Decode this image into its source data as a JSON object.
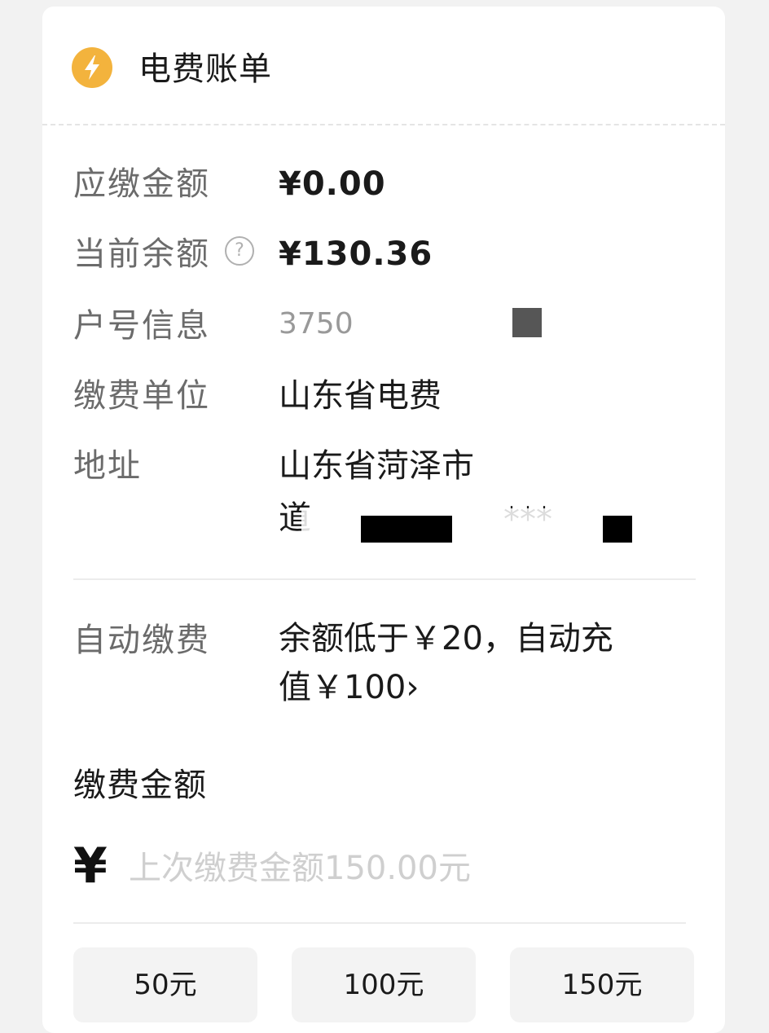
{
  "header": {
    "title": "电费账单",
    "icon": "lightning-icon",
    "icon_color": "#f3b33d"
  },
  "bill": {
    "amount_due_label": "应缴金额",
    "amount_due_value": "¥0.00",
    "balance_label": "当前余额",
    "balance_value": "¥130.36",
    "account_label": "户号信息",
    "account_value": "3750",
    "payee_label": "缴费单位",
    "payee_value": "山东省电费",
    "address_label": "地址",
    "address_line1": "山东省菏泽市",
    "address_line2": "道",
    "address_masked": "***"
  },
  "auto_pay": {
    "label": "自动缴费",
    "line1": "余额低于￥20，自动充",
    "line2": "值￥100",
    "chevron": "›"
  },
  "payment": {
    "title": "缴费金额",
    "currency": "¥",
    "placeholder": "上次缴费金额150.00元",
    "presets": [
      "50元",
      "100元",
      "150元"
    ]
  }
}
